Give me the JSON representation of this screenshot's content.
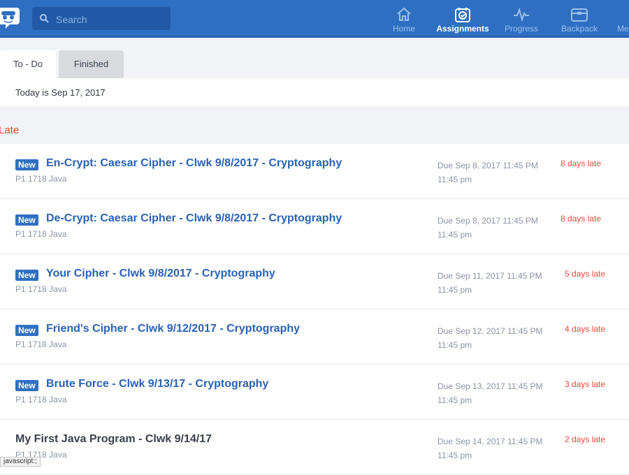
{
  "header": {
    "search_placeholder": "Search",
    "nav": [
      {
        "label": "Home",
        "icon": "home-icon"
      },
      {
        "label": "Assignments",
        "icon": "assignments-icon",
        "active": true
      },
      {
        "label": "Progress",
        "icon": "progress-icon"
      },
      {
        "label": "Backpack",
        "icon": "backpack-icon"
      },
      {
        "label": "Me",
        "icon": "me-icon"
      }
    ]
  },
  "tabs": [
    {
      "label": "To - Do",
      "active": true
    },
    {
      "label": "Finished",
      "active": false
    }
  ],
  "today_text": "Today is Sep 17, 2017",
  "section_title": "Late",
  "assignments": [
    {
      "badge": "New",
      "title": "En-Crypt: Caesar Cipher - Clwk 9/8/2017 - Cryptography",
      "course": "P1 1718 Java",
      "due_line1": "Due Sep 8, 2017 11:45 PM",
      "due_line2": "11:45 pm",
      "late": "8 days late"
    },
    {
      "badge": "New",
      "title": "De-Crypt: Caesar Cipher - Clwk 9/8/2017 - Cryptography",
      "course": "P1 1718 Java",
      "due_line1": "Due Sep 8, 2017 11:45 PM",
      "due_line2": "11:45 pm",
      "late": "8 days late"
    },
    {
      "badge": "New",
      "title": "Your Cipher - Clwk 9/8/2017 - Cryptography",
      "course": "P1 1718 Java",
      "due_line1": "Due Sep 11, 2017 11:45 PM",
      "due_line2": "11:45 pm",
      "late": "5 days late"
    },
    {
      "badge": "New",
      "title": "Friend's Cipher - Clwk 9/12/2017 - Cryptography",
      "course": "P1 1718 Java",
      "due_line1": "Due Sep 12, 2017 11:45 PM",
      "due_line2": "11:45 pm",
      "late": "4 days late"
    },
    {
      "badge": "New",
      "title": "Brute Force - Clwk 9/13/17 - Cryptography",
      "course": "P1 1718 Java",
      "due_line1": "Due Sep 13, 2017 11:45 PM",
      "due_line2": "11:45 pm",
      "late": "3 days late"
    },
    {
      "badge": "",
      "title": "My First Java Program - Clwk 9/14/17",
      "course": "P1 1718 Java",
      "due_line1": "Due Sep 14, 2017 11:45 PM",
      "due_line2": "11:45 pm",
      "late": "2 days late"
    }
  ],
  "status_bar_text": "javascript:;",
  "colors": {
    "header_bg": "#2f6fc2",
    "link": "#2a62b3",
    "late": "#e34b39",
    "badge": "#2f6fc2"
  }
}
